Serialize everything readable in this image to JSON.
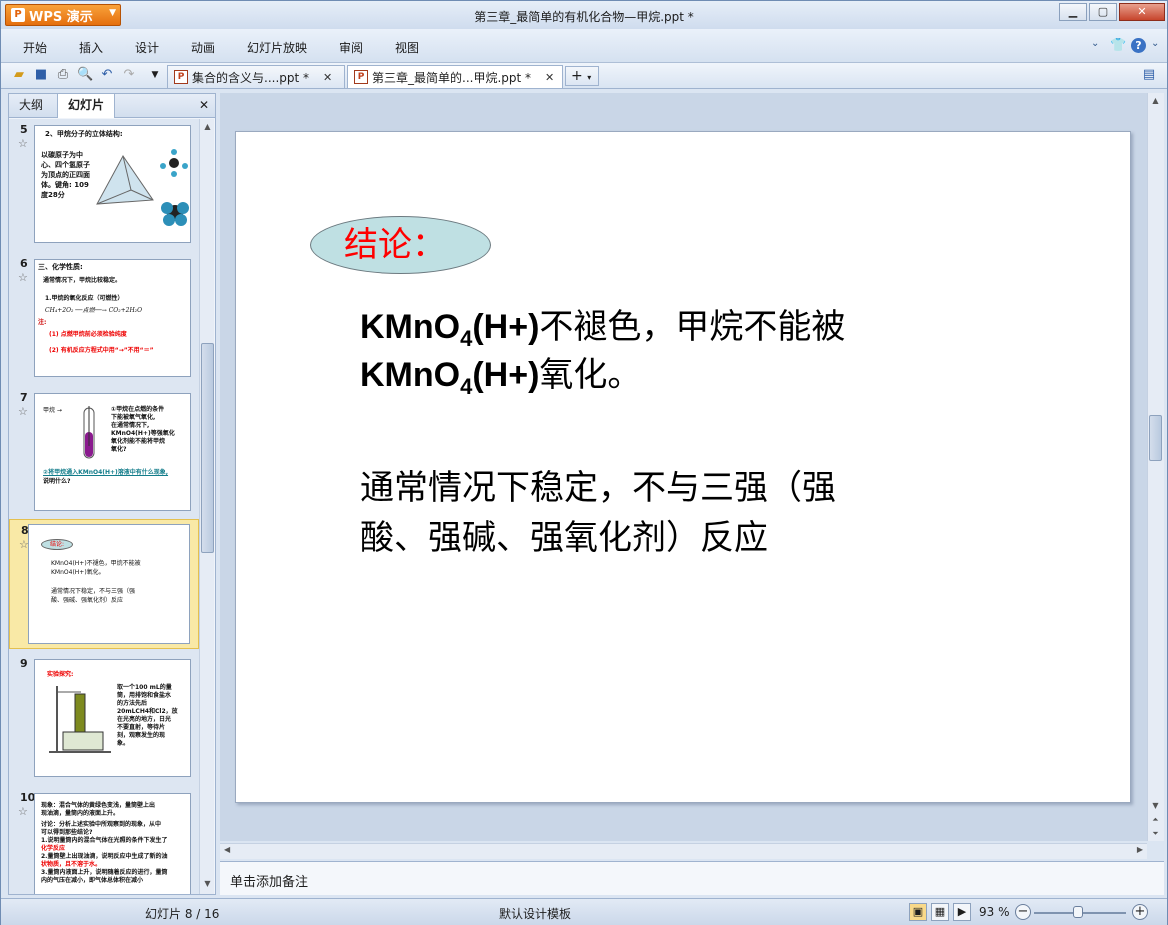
{
  "app": {
    "name": "WPS 演示",
    "window_title": "第三章_最简单的有机化合物—甲烷.ppt *"
  },
  "menu": [
    "开始",
    "插入",
    "设计",
    "动画",
    "幻灯片放映",
    "审阅",
    "视图"
  ],
  "doc_tabs": [
    {
      "label": "集合的含义与....ppt *",
      "active": false
    },
    {
      "label": "第三章_最简单的...甲烷.ppt *",
      "active": true
    }
  ],
  "panel": {
    "tabs": [
      "大纲",
      "幻灯片"
    ],
    "active_tab": "幻灯片"
  },
  "thumbnails": [
    {
      "num": "5",
      "lines": [
        "2、甲烷分子的立体结构:",
        "以碳原子为中",
        "心、四个氢原子",
        "为顶点的正四面",
        "体。键角: 109",
        "度28分"
      ]
    },
    {
      "num": "6",
      "lines": [
        "三、化学性质:",
        "通常情况下，甲烷比较稳定。",
        "1.甲烷的氧化反应（可燃性）",
        "CH₄+2O₂ ──点燃──→ CO₂+2H₂O",
        "注:",
        "(1) 点燃甲烷前必须检验纯度",
        "(2) 有机反应方程式中用“→”不用“＝”"
      ]
    },
    {
      "num": "7",
      "lines": [
        "甲烷 →",
        "①甲烷在点燃的条件",
        "下能被氧气氧化,",
        "在通常情况下,",
        "KMnO4(H+)等强氧化",
        "氧化剂能不能将甲烷",
        "氧化?",
        "②将甲烷通入KMnO4(H+)溶液中有什么现象,",
        "说明什么?"
      ]
    },
    {
      "num": "8",
      "lines": [
        "结论:",
        "KMnO4(H+)不褪色，甲烷不能被",
        "KMnO4(H+)氧化。",
        "通常情况下稳定，不与三强（强",
        "酸、强碱、强氧化剂）反应"
      ]
    },
    {
      "num": "9",
      "lines": [
        "实验探究:",
        "取一个100 mL的量",
        "筒，用排饱和食盐水",
        "的方法先后",
        "20mLCH4和Cl2，放",
        "在光亮的地方，日光",
        "不要直射，等待片",
        "刻，观察发生的现",
        "象。"
      ]
    },
    {
      "num": "10",
      "lines": [
        "现象：混合气体的黄绿色变浅，量筒壁上出",
        "现油滴，量筒内的液面上升。",
        "讨论：分析上述实验中所观察到的现象，从中",
        "可以得到那些结论?",
        "1.说明量筒内的混合气体在光照的条件下发生了",
        "化学反应",
        "2.量筒壁上出现油滴，说明反应中生成了新的油",
        "状物质，且不溶于水。",
        "3.量筒内液面上升，说明随着反应的进行，量筒",
        "内的气压在减小，即气体总体积在减小"
      ]
    }
  ],
  "slide": {
    "conclusion_label": "结论：",
    "line1_formula": "KMnO",
    "line1_sub": "4",
    "line1_formula_tail": "(H+)",
    "line1_text": "不褪色，甲烷不能被",
    "line2_formula": "KMnO",
    "line2_sub": "4",
    "line2_formula_tail": "(H+)",
    "line2_text": "氧化。",
    "line3": "通常情况下稳定，不与三强（强",
    "line4": "酸、强碱、强氧化剂）反应"
  },
  "notes_placeholder": "单击添加备注",
  "status": {
    "slide_counter": "幻灯片 8 / 16",
    "template": "默认设计模板",
    "zoom": "93 %"
  }
}
